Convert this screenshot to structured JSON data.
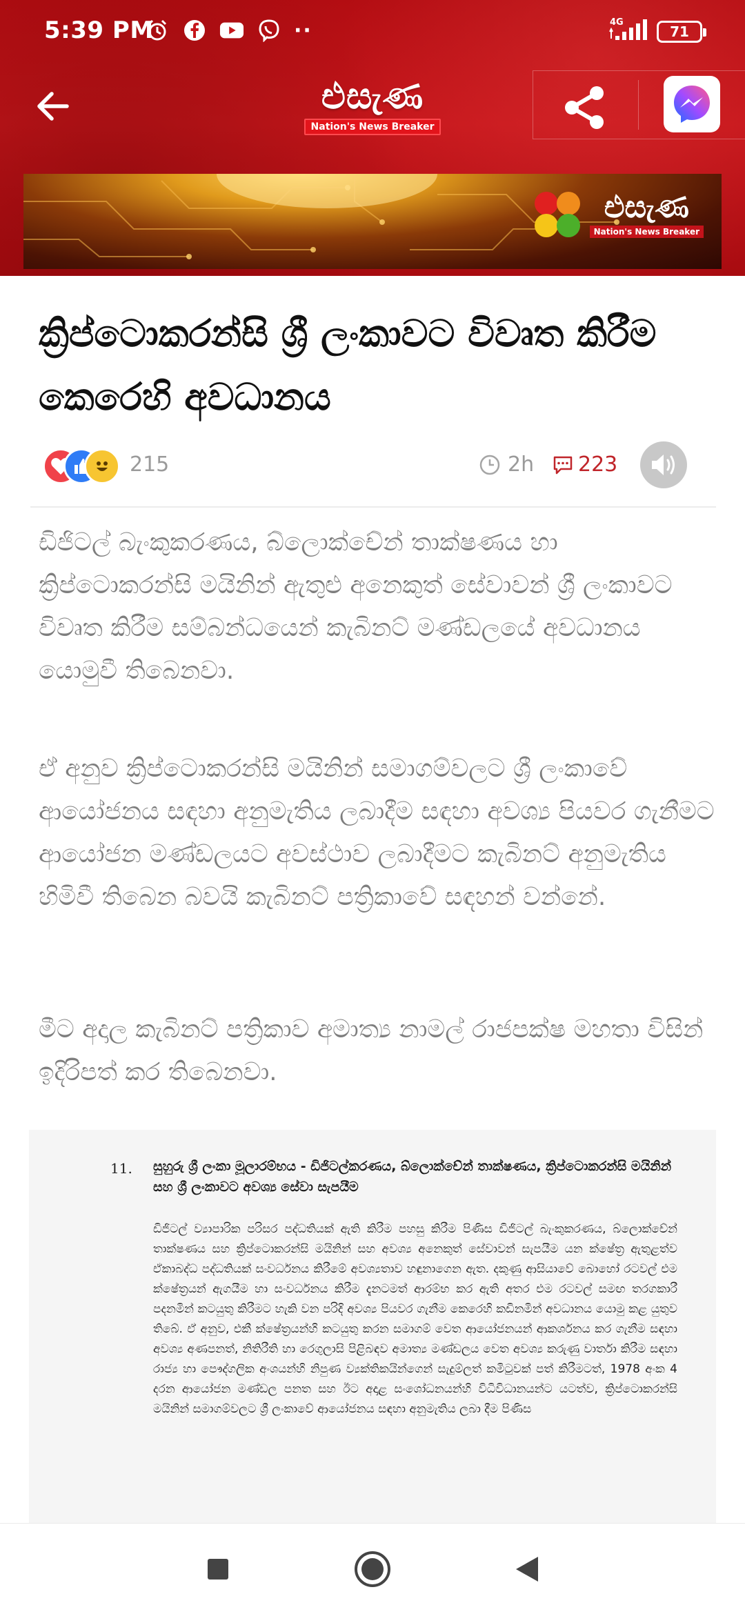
{
  "status_bar": {
    "time": "5:39 PM",
    "network": "4G",
    "battery": "71"
  },
  "header": {
    "logo_text": "එසැණ",
    "logo_tagline": "Nation's News Breaker",
    "back_icon": "arrow-left-icon",
    "share_icon": "share-icon",
    "messenger_icon": "messenger-icon"
  },
  "banner": {
    "logo_text": "එසැණ",
    "logo_tagline": "Nation's News Breaker"
  },
  "article": {
    "title": "ක්‍රිප්ටොකරන්සි ශ්‍රී ලංකාවට විවෘත කිරීම කෙරෙහි අවධානය",
    "reaction_count": "215",
    "time_ago": "2h",
    "comment_count": "223",
    "paragraphs": [
      "ඩිජිටල් බැංකුකරණය, බ්ලොක්චේන් තාක්ෂණය හා ක්‍රිප්ටොකරන්සි මයිනින් ඇතුළු අනෙකුත් සේවාවන් ශ්‍රී ලංකාවට විවෘත කිරීම සම්බන්ධයෙන් කැබිනට් මණ්ඩලයේ අවධානය යොමුවී තිබෙනවා.",
      "ඒ අනුව  ක්‍රිප්ටොකරන්සි මයිනින් සමාගම්වලට ශ්‍රී ලංකාවේ ආයෝජනය සඳහා අනුමැතිය ලබාදීම සඳහා අවශ්‍ය පියවර ගැනීමට ආයෝජන මණ්ඩලයට අවස්ථාව ලබාදීමට කැබිනට් අනුමැතිය හිමිවී තිබෙන බවයි කැබිනට් පත්‍රිකාවේ සඳහන් වන්නේ.",
      "මීට අදාල කැබිනට් පත්‍රිකාව  අමාත්‍ය නාමල් රාජපක්ෂ මහතා විසින් ඉදිරිපත් කර තිබෙනවා."
    ]
  },
  "document": {
    "number": "11.",
    "heading": "සුහුරු ශ්‍රී ලංකා මූලාරම්භය - ඩිජිටල්කරණය, බ්ලොක්චේන් තාක්ෂණය, ක්‍රිප්ටොකරන්සි මයිනින් සහ ශ්‍රී ලංකාවට අවශ්‍ය සේවා සැපයීම",
    "body": "ඩිජිටල් ව්‍යාපාරික පරිසර පද්ධතියක් ඇති කිරීම පහසු කිරීම පිණිස ඩිජිටල් බැංකුකරණය, බ්ලොක්චේන් තාක්ෂණය සහ ක්‍රිප්ටොකරන්සි මයිනින් සහ අවශ්‍ය අනෙකුත් සේවාවන් සැපයීම යන ක්ෂේත්‍ර ඇතුළත්ව ඒකාබද්ධ පද්ධතියක් සංවර්ධනය කිරීමේ අවශ්‍යතාව හඳුනාගෙන ඇත. දකුණු ආසියාවේ බොහෝ රටවල් එම ක්ෂේත්‍රයන් ඇගයීම හා සංවර්ධනය කිරීම දැනටමත් ආරම්භ කර ඇති අතර එම රටවල් සමඟ තරගකාරී පදනමින් කටයුතු කිරීමට හැකි වන පරිදි අවශ්‍ය පියවර ගැනීම කෙරෙහි කඩිනමින් අවධානය යොමු කළ යුතුව තිබේ. ඒ අනුව, එකී ක්ෂේත්‍රයන්හි කටයුතු කරන සමාගම් වෙත ආයෝජනයන් ආකර්ශනය කර ගැනීම සඳහා අවශ්‍ය අණපනත්, නිතිරීති හා රෙගුලාසි පිළිබඳව අමාත්‍ය මණ්ඩලය වෙත අවශ්‍ය කරුණු වාර්තා කිරීම සඳහා රාජ්‍ය හා පෞද්ගලික අංශයන්හි නිපුණ ව්‍යක්තිකයින්ගෙන් සැදුම්ලත් කමිටුවක් පත් කිරීමටත්, 1978 අංක 4 දරන ආයෝජන මණ්ඩල පනත සහ ඊට අදාළ සංශෝධනයන්හි විධිවිධානයන්ට යටත්ව, ක්‍රිප්ටොකරන්සි මයිනින් සමාගම්වලට ශ්‍රී ලංකාවේ ආයෝජනය සඳහා අනුමැතිය ලබා දීම පිණිස"
  },
  "navbar": {
    "recents_icon": "square-icon",
    "home_icon": "circle-home-icon",
    "back_icon": "triangle-back-icon"
  },
  "colors": {
    "header_red": "#c5161b",
    "accent_red": "#c0252a",
    "text_gray": "#7e7e7e"
  }
}
